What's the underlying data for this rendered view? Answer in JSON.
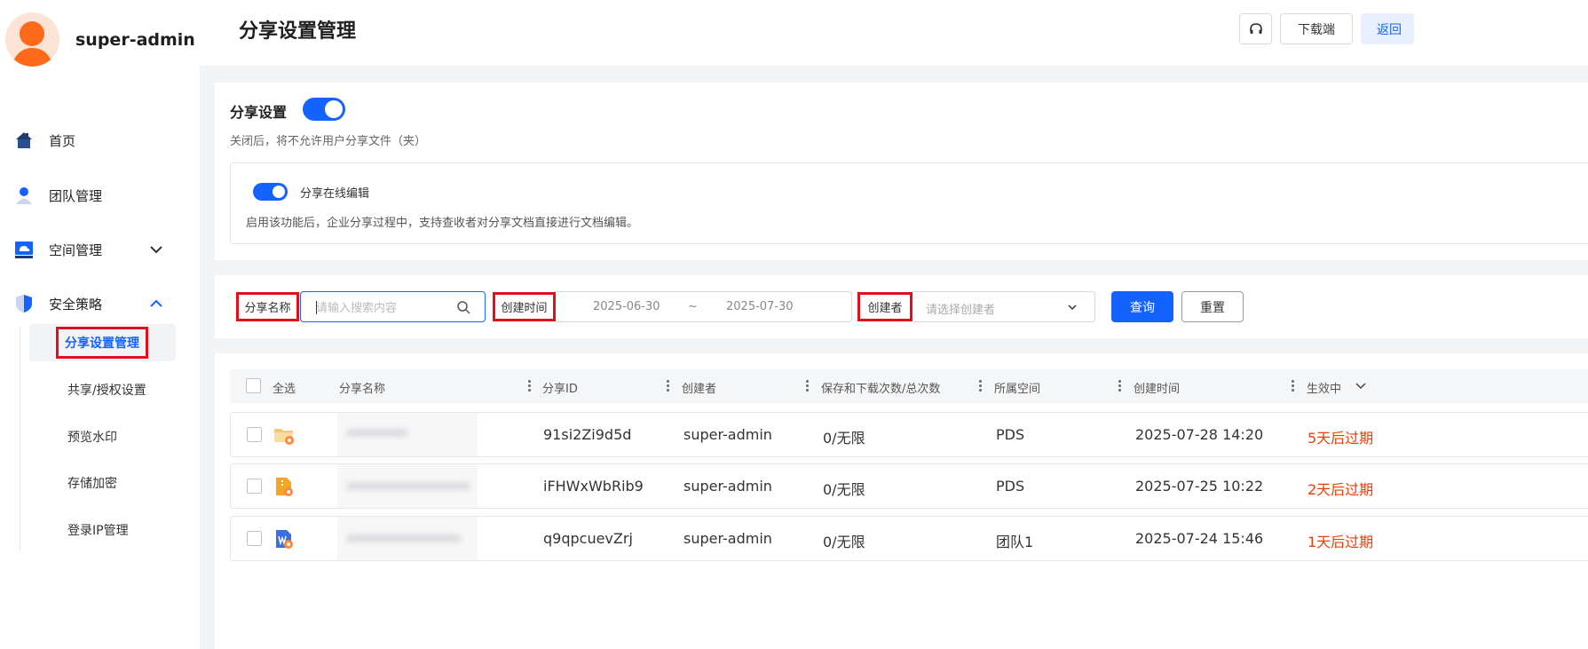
{
  "user": {
    "name": "super-admin"
  },
  "sidebar": {
    "items": [
      {
        "label": "首页",
        "icon": "home-icon"
      },
      {
        "label": "团队管理",
        "icon": "user-icon"
      },
      {
        "label": "空间管理",
        "icon": "cloud-storage-icon"
      },
      {
        "label": "安全策略",
        "icon": "shield-icon"
      }
    ],
    "security_sub": [
      {
        "label": "分享设置管理",
        "active": true
      },
      {
        "label": "共享/授权设置"
      },
      {
        "label": "预览水印"
      },
      {
        "label": "存储加密"
      },
      {
        "label": "登录IP管理"
      }
    ]
  },
  "header": {
    "title": "分享设置管理",
    "download_label": "下载端",
    "back_label": "返回"
  },
  "settings": {
    "title": "分享设置",
    "enabled": true,
    "desc": "关闭后，将不允许用户分享文件（夹）",
    "online_edit": {
      "title": "分享在线编辑",
      "enabled": true,
      "desc": "启用该功能后，企业分享过程中，支持查收者对分享文档直接进行文档编辑。"
    }
  },
  "filters": {
    "name_label": "分享名称",
    "name_placeholder": "请输入搜索内容",
    "time_label": "创建时间",
    "date_start": "2025-06-30",
    "date_sep": "~",
    "date_end": "2025-07-30",
    "creator_label": "创建者",
    "creator_placeholder": "请选择创建者",
    "query_label": "查询",
    "reset_label": "重置"
  },
  "table": {
    "columns": [
      "全选",
      "分享名称",
      "分享ID",
      "创建者",
      "保存和下载次数/总次数",
      "所属空间",
      "创建时间",
      "生效中"
    ],
    "rows": [
      {
        "id": "91si2Zi9d5d",
        "creator": "super-admin",
        "count": "0/无限",
        "space": "PDS",
        "created": "2025-07-28 14:20",
        "status": "5天后过期",
        "icon": "shared-folder-icon"
      },
      {
        "id": "iFHWxWbRib9",
        "creator": "super-admin",
        "count": "0/无限",
        "space": "PDS",
        "created": "2025-07-25 10:22",
        "status": "2天后过期",
        "icon": "shared-archive-icon"
      },
      {
        "id": "q9qpcuevZrj",
        "creator": "super-admin",
        "count": "0/无限",
        "space": "团队1",
        "created": "2025-07-24 15:46",
        "status": "1天后过期",
        "icon": "shared-word-doc-icon"
      }
    ]
  },
  "colors": {
    "primary": "#1463ff",
    "highlight": "#e0101a",
    "expire": "#e8400c"
  }
}
